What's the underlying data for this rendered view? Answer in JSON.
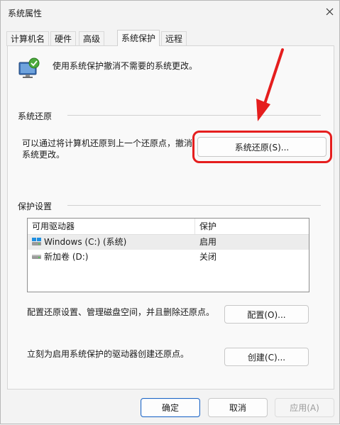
{
  "window": {
    "title": "系统属性"
  },
  "tabs": [
    {
      "label": "计算机名",
      "active": false
    },
    {
      "label": "硬件",
      "active": false
    },
    {
      "label": "高级",
      "active": false
    },
    {
      "label": "系统保护",
      "active": true
    },
    {
      "label": "远程",
      "active": false
    }
  ],
  "intro": {
    "text": "使用系统保护撤消不需要的系统更改。"
  },
  "restore": {
    "group_title": "系统还原",
    "description_line1": "可以通过将计算机还原到上一个还原点，撤消",
    "description_line2": "系统更改。",
    "button_label": "系统还原(S)..."
  },
  "protection": {
    "group_title": "保护设置",
    "columns": [
      "可用驱动器",
      "保护"
    ],
    "rows": [
      {
        "drive": "Windows (C:) (系统)",
        "status": "启用",
        "icon": "system-drive-icon"
      },
      {
        "drive": "新加卷 (D:)",
        "status": "关闭",
        "icon": "drive-icon"
      }
    ],
    "configure_text": "配置还原设置、管理磁盘空间，并且删除还原点。",
    "configure_button": "配置(O)...",
    "create_text": "立刻为启用系统保护的驱动器创建还原点。",
    "create_button": "创建(C)..."
  },
  "footer": {
    "ok": "确定",
    "cancel": "取消",
    "apply": "应用(A)"
  },
  "colors": {
    "accent": "#1e66c5",
    "highlight": "#e51e1e"
  }
}
